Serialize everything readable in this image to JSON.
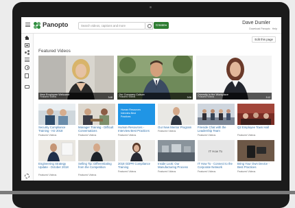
{
  "app": {
    "name": "Panopto",
    "brand_color": "#2c8c3c"
  },
  "header": {
    "search_placeholder": "Search videos, captions and more",
    "create_label": "Create",
    "user_name": "Dave Dumler",
    "links": [
      "Download Panopto",
      "Help"
    ]
  },
  "toolbar": {
    "edit_label": "Edit this page"
  },
  "section": {
    "title": "Featured Videos"
  },
  "featured": [
    {
      "title": "New Employee Welcome",
      "subtitle": "Featured Videos",
      "duration": "3:48"
    },
    {
      "title": "Our Company Culture",
      "subtitle": "Featured Videos",
      "duration": "3:06"
    },
    {
      "title": "Diversity in the Workplace",
      "subtitle": "Featured Videos",
      "duration": "3:12"
    }
  ],
  "grid": [
    {
      "title": "Security Compliance Training - H2 2018",
      "subtitle": "Featured Videos"
    },
    {
      "title": "Manager Training - Difficult Conversations",
      "subtitle": "Featured Videos"
    },
    {
      "title": "Human Resources - Interview Best Practices",
      "subtitle": "Featured Videos"
    },
    {
      "title": "Our New Mentor Program",
      "subtitle": "Featured Videos"
    },
    {
      "title": "Fireside Chat with the Leadership Team",
      "subtitle": "Featured Videos"
    },
    {
      "title": "Q2 Employee Town Hall",
      "subtitle": "Featured Videos"
    },
    {
      "title": "Engineering Strategy Update - October 2018",
      "subtitle": "Featured Videos"
    },
    {
      "title": "Selling Tip: Differentiating from the Competition",
      "subtitle": "Featured Videos"
    },
    {
      "title": "2018 GDPR Compliance Training",
      "subtitle": "Featured Videos"
    },
    {
      "title": "Inside Look: Our Manufacturing Process",
      "subtitle": "Featured Videos"
    },
    {
      "title": "IT How To - Connect to the Corporate Network",
      "subtitle": "Featured Videos"
    },
    {
      "title": "Bring Your Own Device - Best Practices",
      "subtitle": "Featured Videos"
    }
  ],
  "thumb_overlay_text": {
    "human_resources": "Human Resources\nInterview Best\nPractices",
    "it_how_to": "IT How To"
  },
  "sidebar_icons": [
    "home-icon",
    "library-icon",
    "share-icon",
    "list-icon",
    "clock-icon",
    "document-icon",
    "folder-icon",
    "settings-icon"
  ]
}
